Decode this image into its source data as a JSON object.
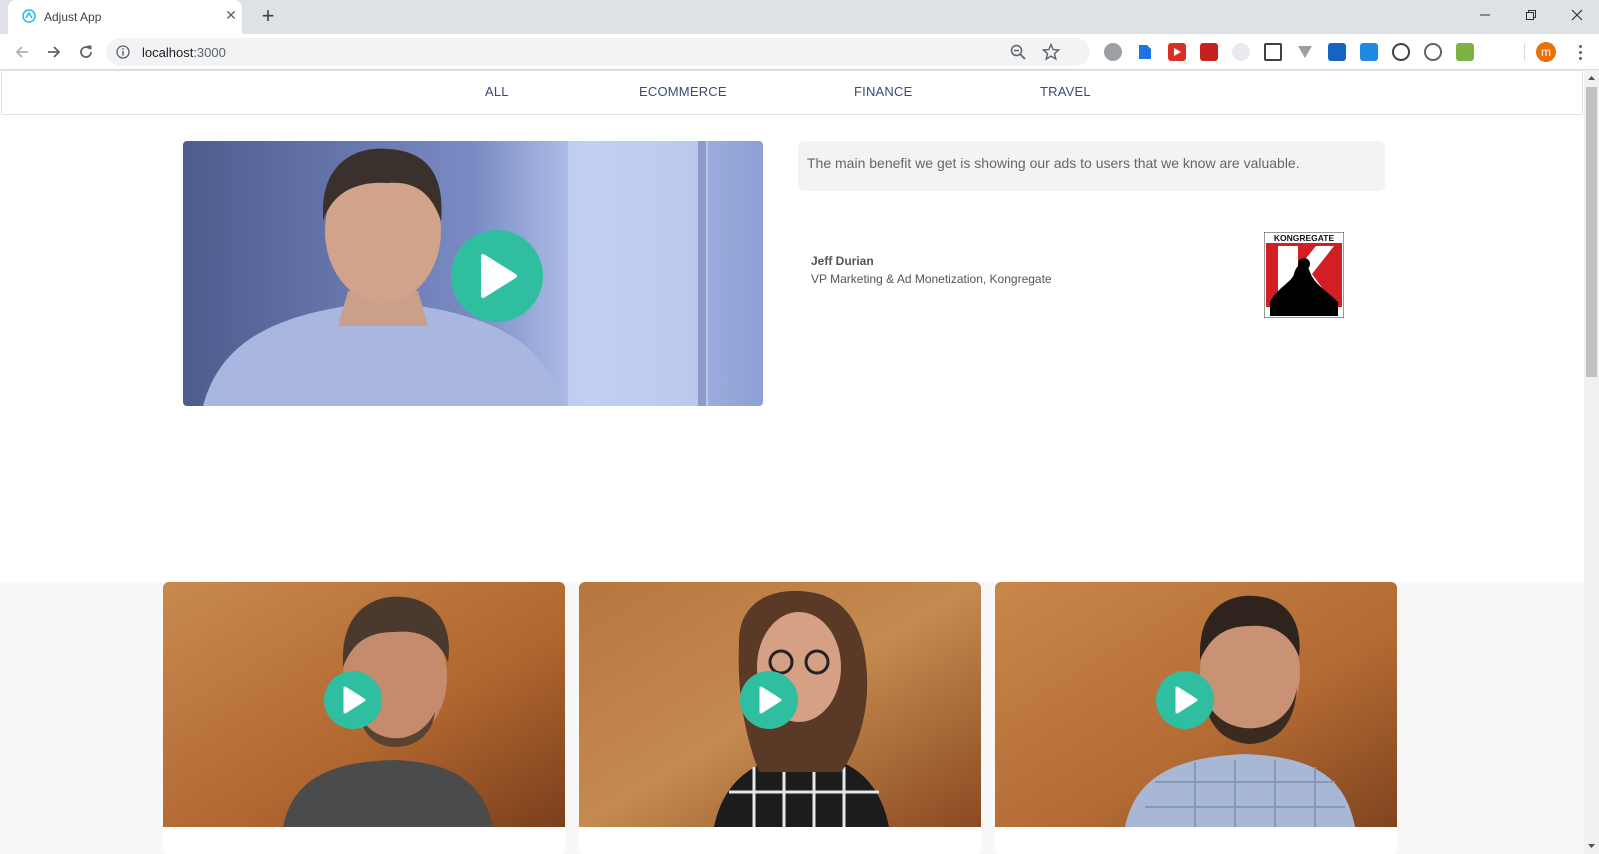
{
  "browser": {
    "tab_title": "Adjust App",
    "new_tab_symbol": "+",
    "close_symbol": "✕",
    "url_host": "localhost",
    "url_port": ":3000",
    "profile_initial": "m"
  },
  "nav": {
    "items": [
      "ALL",
      "ECOMMERCE",
      "FINANCE",
      "TRAVEL"
    ]
  },
  "featured": {
    "quote": "The main benefit we get is showing our ads to users that we know are valuable.",
    "author_name": "Jeff Durian",
    "author_title": "VP Marketing & Ad Monetization, Kongregate",
    "logo_text": "KONGREGATE"
  },
  "videos": [
    {
      "thumbnail": "person-photo",
      "play_icon": "play-icon"
    },
    {
      "thumbnail": "person-photo",
      "play_icon": "play-icon"
    },
    {
      "thumbnail": "person-photo",
      "play_icon": "play-icon"
    }
  ],
  "colors": {
    "accent_play": "#2fbfa0",
    "nav_text": "#3b4a78",
    "quote_bg": "#f3f3f3"
  }
}
